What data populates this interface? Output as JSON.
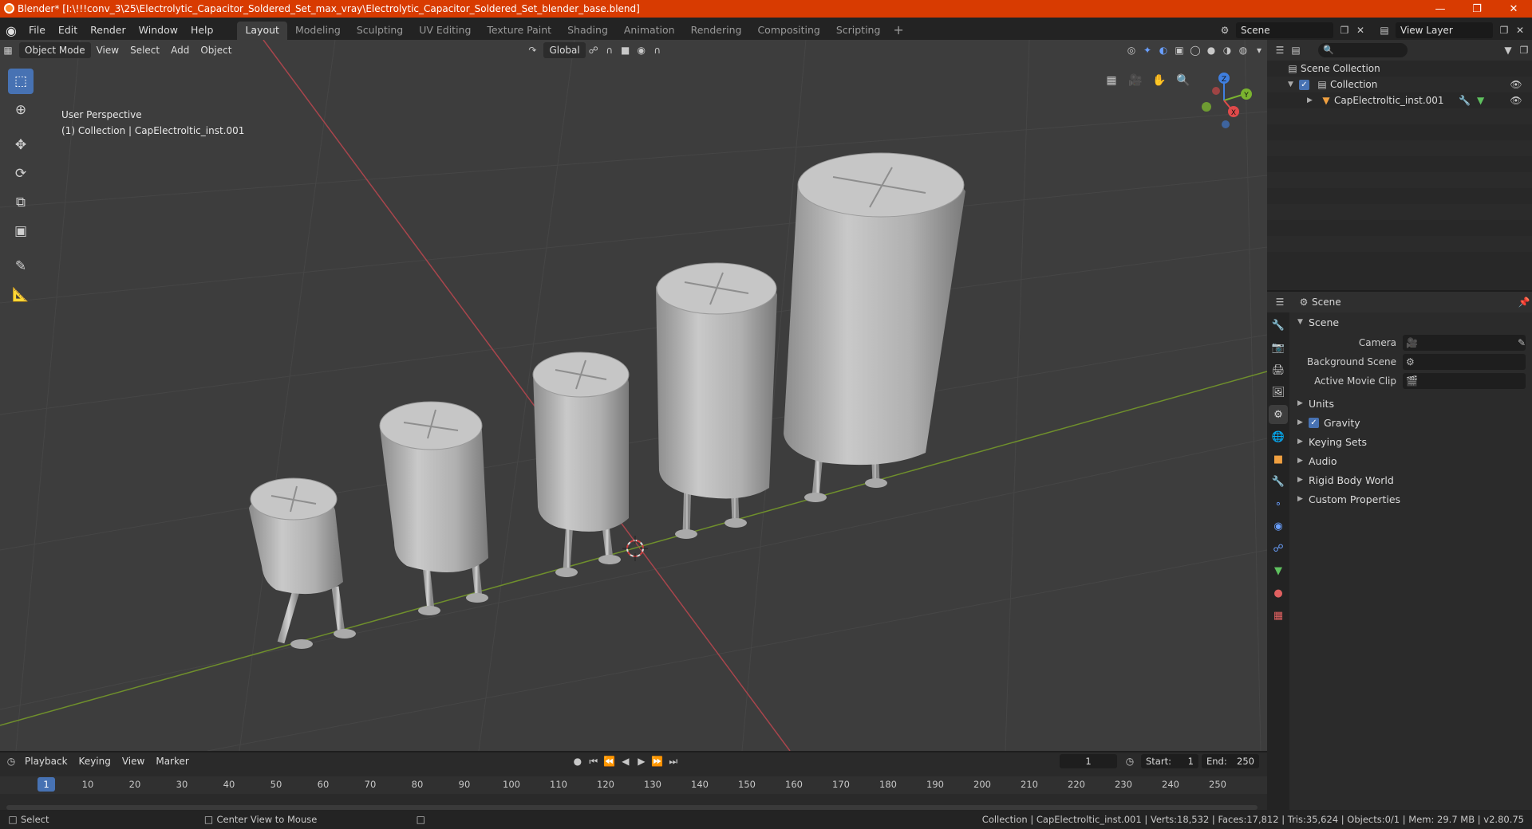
{
  "title": "Blender* [I:\\!!!conv_3\\25\\Electrolytic_Capacitor_Soldered_Set_max_vray\\Electrolytic_Capacitor_Soldered_Set_blender_base.blend]",
  "menu": [
    "File",
    "Edit",
    "Render",
    "Window",
    "Help"
  ],
  "workspaces": [
    "Layout",
    "Modeling",
    "Sculpting",
    "UV Editing",
    "Texture Paint",
    "Shading",
    "Animation",
    "Rendering",
    "Compositing",
    "Scripting"
  ],
  "scene_name": "Scene",
  "view_layer": "View Layer",
  "viewport": {
    "mode": "Object Mode",
    "menus": [
      "View",
      "Select",
      "Add",
      "Object"
    ],
    "orientation": "Global",
    "perspective": "User Perspective",
    "collection_info": "(1) Collection | CapElectroltic_inst.001"
  },
  "gizmo": {
    "x": "X",
    "y": "Y",
    "z": "Z"
  },
  "outliner": {
    "root": "Scene Collection",
    "collection": "Collection",
    "object": "CapElectroltic_inst.001"
  },
  "properties": {
    "context": "Scene",
    "section": "Scene",
    "camera_label": "Camera",
    "background_label": "Background Scene",
    "movieclip_label": "Active Movie Clip",
    "panels": [
      "Units",
      "Gravity",
      "Keying Sets",
      "Audio",
      "Rigid Body World",
      "Custom Properties"
    ]
  },
  "timeline": {
    "menus": [
      "Playback",
      "Keying",
      "View",
      "Marker"
    ],
    "current_frame": "1",
    "start_label": "Start:",
    "start": "1",
    "end_label": "End:",
    "end": "250",
    "ticks": [
      "10",
      "20",
      "30",
      "40",
      "50",
      "60",
      "70",
      "80",
      "90",
      "100",
      "110",
      "120",
      "130",
      "140",
      "150",
      "160",
      "170",
      "180",
      "190",
      "200",
      "210",
      "220",
      "230",
      "240",
      "250"
    ]
  },
  "status": {
    "left": "Select",
    "middle": "Center View to Mouse",
    "right": "Collection | CapElectroltic_inst.001 | Verts:18,532 | Faces:17,812 | Tris:35,624 | Objects:0/1 | Mem: 29.7 MB | v2.80.75"
  },
  "colors": {
    "accent": "#4772b3",
    "titlebar": "#d83b01",
    "x_axis": "#e04a4a",
    "y_axis": "#7ab32f",
    "z_axis": "#3f7fe0"
  }
}
